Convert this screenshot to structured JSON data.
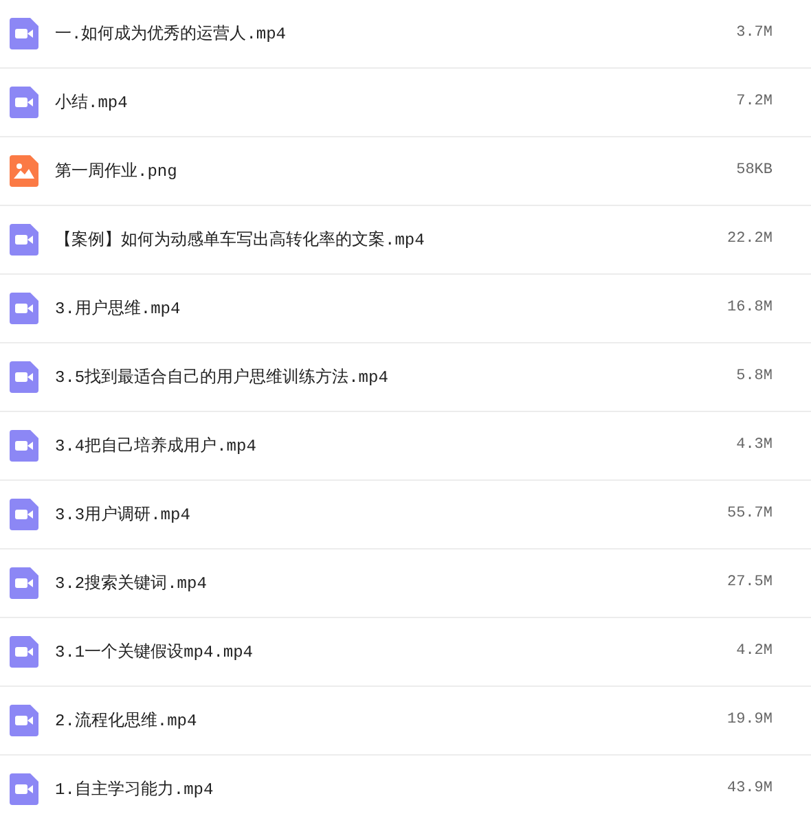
{
  "files": [
    {
      "kind": "video",
      "name": "一.如何成为优秀的运营人.mp4",
      "size": "3.7M"
    },
    {
      "kind": "video",
      "name": "小结.mp4",
      "size": "7.2M"
    },
    {
      "kind": "image",
      "name": "第一周作业.png",
      "size": "58KB"
    },
    {
      "kind": "video",
      "name": "【案例】如何为动感单车写出高转化率的文案.mp4",
      "size": "22.2M"
    },
    {
      "kind": "video",
      "name": "3.用户思维.mp4",
      "size": "16.8M"
    },
    {
      "kind": "video",
      "name": "3.5找到最适合自己的用户思维训练方法.mp4",
      "size": "5.8M"
    },
    {
      "kind": "video",
      "name": "3.4把自己培养成用户.mp4",
      "size": "4.3M"
    },
    {
      "kind": "video",
      "name": "3.3用户调研.mp4",
      "size": "55.7M"
    },
    {
      "kind": "video",
      "name": "3.2搜索关键词.mp4",
      "size": "27.5M"
    },
    {
      "kind": "video",
      "name": "3.1一个关键假设mp4.mp4",
      "size": "4.2M"
    },
    {
      "kind": "video",
      "name": "2.流程化思维.mp4",
      "size": "19.9M"
    },
    {
      "kind": "video",
      "name": "1.自主学习能力.mp4",
      "size": "43.9M"
    }
  ]
}
